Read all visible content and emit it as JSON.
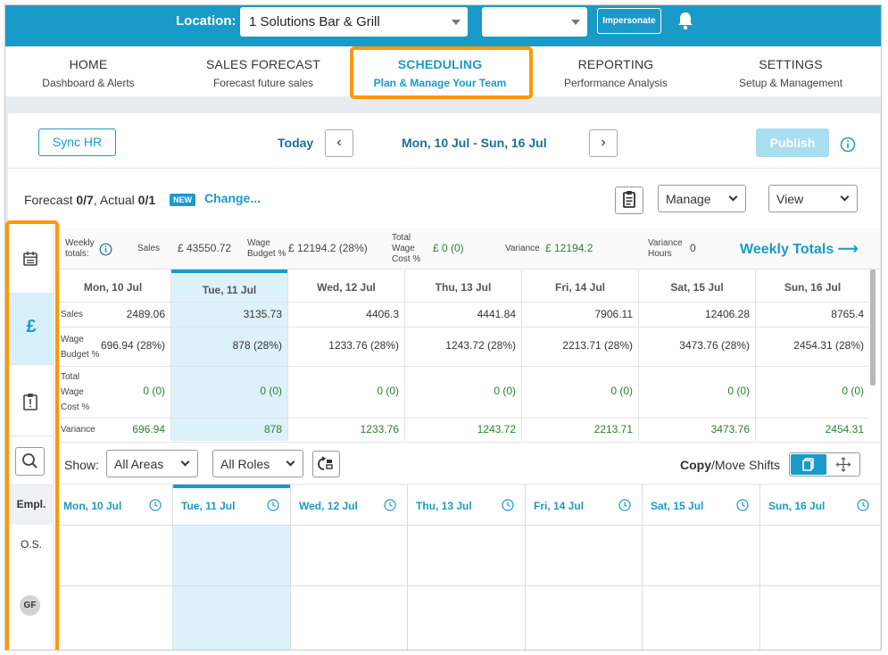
{
  "header": {
    "location_label": "Location:",
    "location_value": "1 Solutions Bar & Grill",
    "secondary_select_value": "",
    "impersonate_label": "Impersonate"
  },
  "nav": [
    {
      "title": "HOME",
      "subtitle": "Dashboard & Alerts",
      "active": false
    },
    {
      "title": "SALES FORECAST",
      "subtitle": "Forecast future sales",
      "active": false
    },
    {
      "title": "SCHEDULING",
      "subtitle": "Plan & Manage Your Team",
      "active": true
    },
    {
      "title": "REPORTING",
      "subtitle": "Performance Analysis",
      "active": false
    },
    {
      "title": "SETTINGS",
      "subtitle": "Setup & Management",
      "active": false
    }
  ],
  "toolbar": {
    "sync_label": "Sync HR",
    "today_label": "Today",
    "prev_symbol": "‹",
    "next_symbol": "›",
    "date_range": "Mon, 10 Jul - Sun, 16 Jul",
    "publish_label": "Publish"
  },
  "forecast_bar": {
    "forecast_label": "Forecast",
    "forecast_value": "0/7",
    "actual_label": "Actual",
    "actual_value": "0/1",
    "new_badge": "NEW",
    "change_link": "Change...",
    "manage_label": "Manage",
    "view_label": "View"
  },
  "weekly_totals": {
    "label_line1": "Weekly",
    "label_line2": "totals:",
    "sales_label": "Sales",
    "sales_value": "£ 43550.72",
    "wage_budget_label_1": "Wage",
    "wage_budget_label_2": "Budget %",
    "wage_budget_value": "£ 12194.2 (28%)",
    "total_wage_label_1": "Total",
    "total_wage_label_2": "Wage",
    "total_wage_label_3": "Cost %",
    "total_wage_value": "£ 0 (0)",
    "variance_label": "Variance",
    "variance_value": "£ 12194.2",
    "variance_hours_label_1": "Variance",
    "variance_hours_label_2": "Hours",
    "variance_hours_value": "0",
    "weekly_totals_link": "Weekly Totals ⟶"
  },
  "row_labels": {
    "sales": "Sales",
    "wage_budget_1": "Wage",
    "wage_budget_2": "Budget %",
    "total_wage_1": "Total",
    "total_wage_2": "Wage",
    "total_wage_3": "Cost %",
    "variance": "Variance"
  },
  "days": [
    {
      "header": "Mon, 10 Jul",
      "sales": "2489.06",
      "wage_budget": "696.94 (28%)",
      "total_wage": "0 (0)",
      "variance": "696.94"
    },
    {
      "header": "Tue, 11 Jul",
      "sales": "3135.73",
      "wage_budget": "878 (28%)",
      "total_wage": "0 (0)",
      "variance": "878"
    },
    {
      "header": "Wed, 12 Jul",
      "sales": "4406.3",
      "wage_budget": "1233.76 (28%)",
      "total_wage": "0 (0)",
      "variance": "1233.76"
    },
    {
      "header": "Thu, 13 Jul",
      "sales": "4441.84",
      "wage_budget": "1243.72 (28%)",
      "total_wage": "0 (0)",
      "variance": "1243.72"
    },
    {
      "header": "Fri, 14 Jul",
      "sales": "7906.11",
      "wage_budget": "2213.71 (28%)",
      "total_wage": "0 (0)",
      "variance": "2213.71"
    },
    {
      "header": "Sat, 15 Jul",
      "sales": "12406.28",
      "wage_budget": "3473.76 (28%)",
      "total_wage": "0 (0)",
      "variance": "3473.76"
    },
    {
      "header": "Sun, 16 Jul",
      "sales": "8765.4",
      "wage_budget": "2454.31 (28%)",
      "total_wage": "0 (0)",
      "variance": "2454.31"
    }
  ],
  "filters": {
    "show_label": "Show:",
    "areas_value": "All Areas",
    "roles_value": "All Roles",
    "copy_bold": "Copy",
    "copy_rest": "/Move Shifts"
  },
  "schedule_headers": [
    "Mon, 10 Jul",
    "Tue, 11 Jul",
    "Wed, 12 Jul",
    "Thu, 13 Jul",
    "Fri, 14 Jul",
    "Sat, 15 Jul",
    "Sun, 16 Jul"
  ],
  "sidebar": {
    "pound_symbol": "£",
    "empl_label": "Empl.",
    "open_shifts_label": "O.S.",
    "employee_initials": "GF"
  },
  "colors": {
    "brand": "#1a9ac9",
    "highlight": "#ff9800",
    "positive": "#2e7d32",
    "selected_day": "#ddf1fa"
  }
}
